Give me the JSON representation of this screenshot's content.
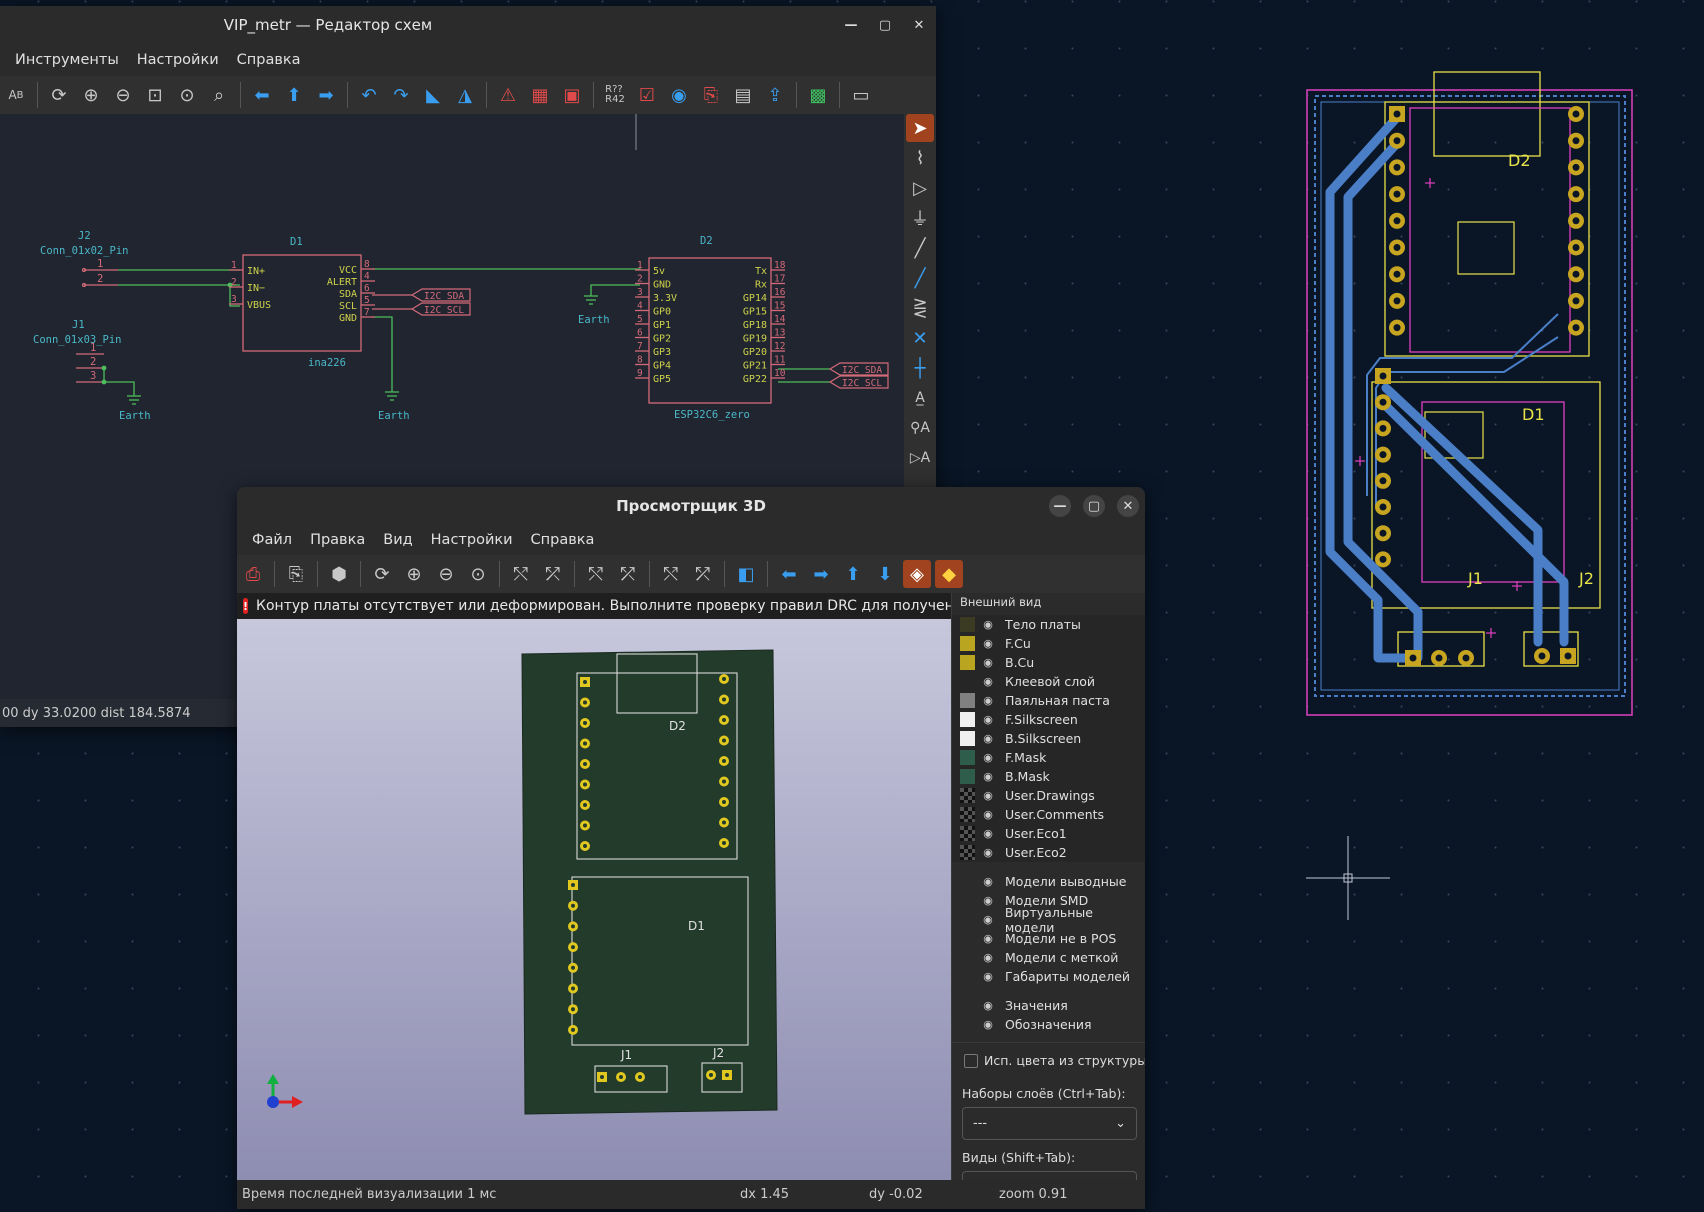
{
  "schematic": {
    "title": "VIP_metr — Редактор схем",
    "menu": [
      "Инструменты",
      "Настройки",
      "Справка"
    ],
    "status": "00  dy 33.0200  dist 184.5874",
    "labels": {
      "j2_ref": "J2",
      "j2_val": "Conn_01x02_Pin",
      "j1_ref": "J1",
      "j1_val": "Conn_01x03_Pin",
      "d1_ref": "D1",
      "d1_val": "ina226",
      "d2_ref": "D2",
      "d2_val": "ESP32C6_zero",
      "earth": "Earth",
      "i2c_sda": "I2C_SDA",
      "i2c_scl": "I2C_SCL"
    },
    "d1_left_pins": [
      {
        "num": "1",
        "name": "IN+"
      },
      {
        "num": "2",
        "name": "IN−"
      },
      {
        "num": "3",
        "name": "VBUS"
      }
    ],
    "d1_right_pins": [
      {
        "num": "8",
        "name": "VCC"
      },
      {
        "num": "4",
        "name": "ALERT"
      },
      {
        "num": "6",
        "name": "SDA"
      },
      {
        "num": "5",
        "name": "SCL"
      },
      {
        "num": "7",
        "name": "GND"
      }
    ],
    "d2_left_pins": [
      {
        "num": "1",
        "name": "5v"
      },
      {
        "num": "2",
        "name": "GND"
      },
      {
        "num": "3",
        "name": "3.3V"
      },
      {
        "num": "4",
        "name": "GP0"
      },
      {
        "num": "5",
        "name": "GP1"
      },
      {
        "num": "6",
        "name": "GP2"
      },
      {
        "num": "7",
        "name": "GP3"
      },
      {
        "num": "8",
        "name": "GP4"
      },
      {
        "num": "9",
        "name": "GP5"
      }
    ],
    "d2_right_pins": [
      {
        "num": "18",
        "name": "Tx"
      },
      {
        "num": "17",
        "name": "Rx"
      },
      {
        "num": "16",
        "name": "GP14"
      },
      {
        "num": "15",
        "name": "GP15"
      },
      {
        "num": "14",
        "name": "GP18"
      },
      {
        "num": "13",
        "name": "GP19"
      },
      {
        "num": "12",
        "name": "GP20"
      },
      {
        "num": "11",
        "name": "GP21"
      },
      {
        "num": "10",
        "name": "GP22"
      }
    ],
    "j2_pins": [
      "1",
      "2"
    ],
    "j1_pins": [
      "1",
      "2",
      "3"
    ]
  },
  "viewer3d": {
    "title": "Просмотрщик 3D",
    "menu": [
      "Файл",
      "Правка",
      "Вид",
      "Настройки",
      "Справка"
    ],
    "warning": "Контур платы отсутствует или деформирован. Выполните проверку правил DRC для получения",
    "board_labels": {
      "d2": "D2",
      "d1": "D1",
      "j1": "J1",
      "j2": "J2"
    },
    "panel_title": "Внешний вид",
    "layers": [
      {
        "name": "Тело платы",
        "color": "#3b3a22"
      },
      {
        "name": "F.Cu",
        "color": "#b9a51f"
      },
      {
        "name": "B.Cu",
        "color": "#b9a51f"
      },
      {
        "name": "Клеевой слой",
        "color": ""
      },
      {
        "name": "Паяльная паста",
        "color": "#808080"
      },
      {
        "name": "F.Silkscreen",
        "color": "#efefef"
      },
      {
        "name": "B.Silkscreen",
        "color": "#efefef"
      },
      {
        "name": "F.Mask",
        "color": "#2e5d4b"
      },
      {
        "name": "B.Mask",
        "color": "#2e5d4b"
      },
      {
        "name": "User.Drawings",
        "color": "checker"
      },
      {
        "name": "User.Comments",
        "color": "checker"
      },
      {
        "name": "User.Eco1",
        "color": "checker"
      },
      {
        "name": "User.Eco2",
        "color": "checker"
      }
    ],
    "models": [
      "Модели выводные",
      "Модели SMD",
      "Виртуальные модели",
      "Модели не в POS",
      "Модели с меткой",
      "Габариты моделей"
    ],
    "texts": [
      "Значения",
      "Обозначения"
    ],
    "use_colors_label": "Исп. цвета из структуры",
    "layer_presets_label": "Наборы слоёв (Ctrl+Tab):",
    "layer_presets_value": "---",
    "views_label": "Виды (Shift+Tab):",
    "views_value": "---",
    "status": {
      "render": "Время последней визуализации 1 мс",
      "dx": "dx 1.45",
      "dy": "dy -0.02",
      "zoom": "zoom 0.91"
    }
  },
  "pcb": {
    "labels": {
      "d2": "D2",
      "d1": "D1",
      "j1": "J1",
      "j2": "J2"
    }
  },
  "colors": {
    "accent": "#3a9ef0",
    "schematic_body": "#d46a78",
    "schematic_text": "#4ab8c8",
    "silk": "#e8e24a",
    "courtyard": "#e040c0",
    "track": "#4a7fc8"
  }
}
